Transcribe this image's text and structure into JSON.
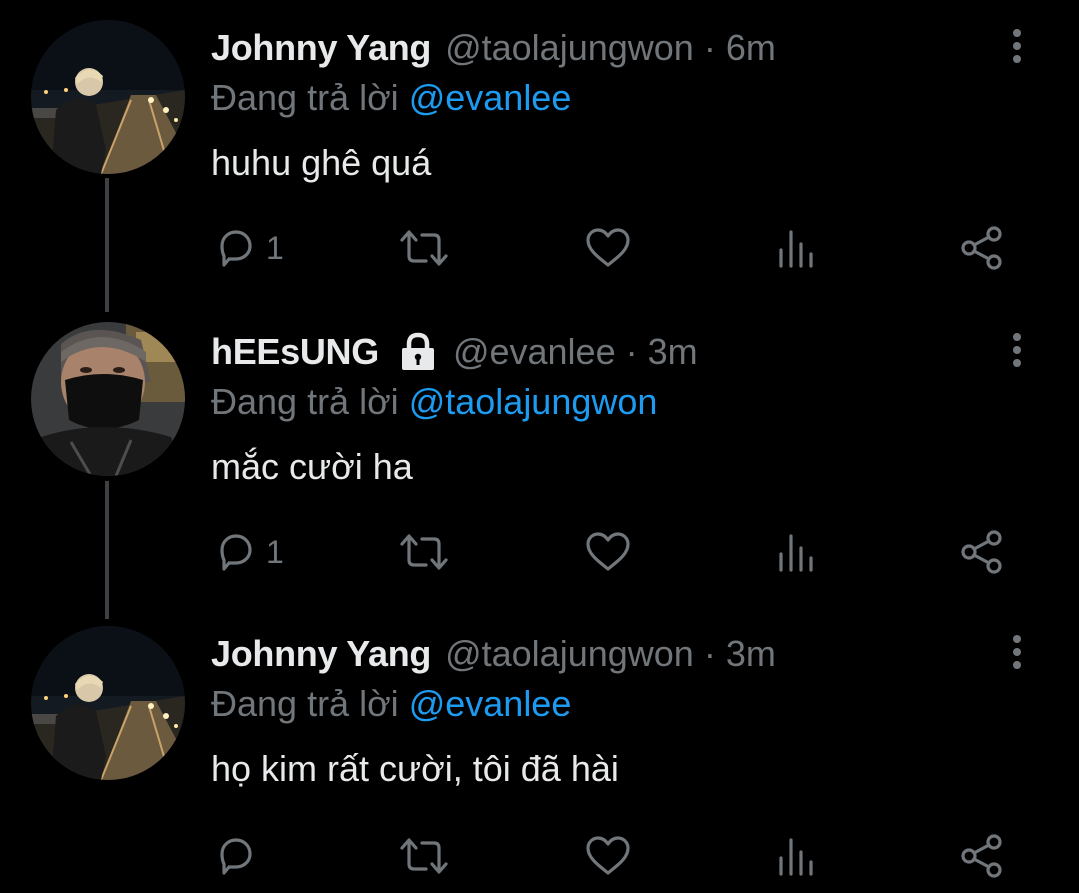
{
  "tweets": [
    {
      "display_name": "Johnny Yang",
      "handle": "@taolajungwon",
      "separator": "·",
      "time": "6m",
      "reply_prefix": "Đang trả lời",
      "reply_to": "@evanlee",
      "text": "huhu ghê quá",
      "reply_count": "1",
      "protected": false
    },
    {
      "display_name": "hEEsUNG",
      "handle": "@evanlee",
      "separator": "·",
      "time": "3m",
      "reply_prefix": "Đang trả lời",
      "reply_to": "@taolajungwon",
      "text": "mắc cười ha",
      "reply_count": "1",
      "protected": true
    },
    {
      "display_name": "Johnny Yang",
      "handle": "@taolajungwon",
      "separator": "·",
      "time": "3m",
      "reply_prefix": "Đang trả lời",
      "reply_to": "@evanlee",
      "text": "họ kim rất cười, tôi đã hài",
      "reply_count": "",
      "protected": false
    }
  ],
  "icons": {
    "reply": "reply-icon",
    "retweet": "retweet-icon",
    "like": "heart-icon",
    "views": "analytics-icon",
    "share": "share-icon",
    "more": "more-vertical-icon",
    "lock": "lock-icon"
  },
  "colors": {
    "background": "#000000",
    "primary_text": "#e7e9ea",
    "secondary_text": "#71767b",
    "mention": "#1d9bf0",
    "thread_line": "#3e4144"
  }
}
